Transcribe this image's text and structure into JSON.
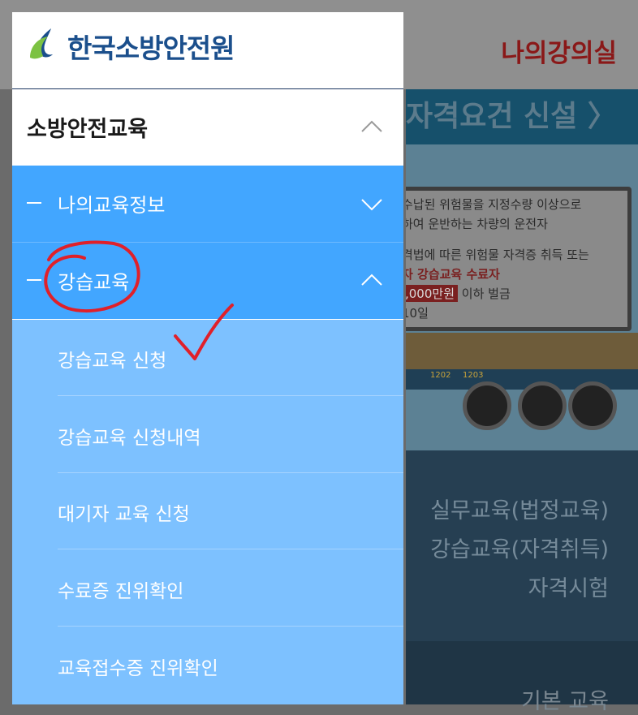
{
  "background": {
    "header_link": "나의강의실",
    "banner_title": "자격요건 신설 〉",
    "banner_lines": [
      "수납된 위험물을 지정수량 이상으로",
      "하여 운반하는 차량의 운전자",
      "격법에 따른 위험물 자격증 취득 또는",
      "자 강습교육 수료자",
      "이하 벌금",
      "10일"
    ],
    "fine_amount": ",000만원",
    "plate_numbers": [
      "1202",
      "1203"
    ],
    "links": [
      "실무교육(법정교육)",
      "강습교육(자격취득)",
      "자격시험"
    ],
    "bottom_link": "기본 교육"
  },
  "drawer": {
    "logo_text": "한국소방안전원",
    "category": {
      "label": "소방안전교육",
      "expanded": true
    },
    "submenus": [
      {
        "label": "나의교육정보",
        "expanded": false
      },
      {
        "label": "강습교육",
        "expanded": true
      }
    ],
    "items": [
      {
        "label": "강습교육 신청"
      },
      {
        "label": "강습교육 신청내역"
      },
      {
        "label": "대기자 교육 신청"
      },
      {
        "label": "수료증 진위확인"
      },
      {
        "label": "교육접수증 진위확인"
      }
    ]
  },
  "colors": {
    "logo_blue": "#1b4f8c",
    "logo_green": "#7cc242",
    "submenu_blue": "#42a6ff",
    "item_blue": "#7dc1ff",
    "annotation_red": "#e0202a"
  }
}
